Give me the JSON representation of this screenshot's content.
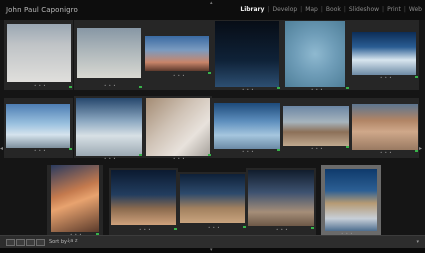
{
  "header": {
    "identity_plate": "John Paul Caponigro",
    "modules": [
      {
        "label": "Library",
        "active": true
      },
      {
        "label": "Develop",
        "active": false
      },
      {
        "label": "Map",
        "active": false
      },
      {
        "label": "Book",
        "active": false
      },
      {
        "label": "Slideshow",
        "active": false
      },
      {
        "label": "Print",
        "active": false
      },
      {
        "label": "Web",
        "active": false
      }
    ],
    "separator": "|"
  },
  "grid": {
    "dots": "• • •",
    "flag_color": "#38b24a",
    "selected_index": 17
  },
  "toolbar": {
    "sort_label": "Sort by :",
    "sort_icon": "↓a z"
  },
  "icons": {
    "left_panel_arrow": "◂",
    "right_panel_arrow": "▸",
    "top_panel_arrow": "▴",
    "bottom_panel_arrow": "▾",
    "dropdown": "▾"
  }
}
